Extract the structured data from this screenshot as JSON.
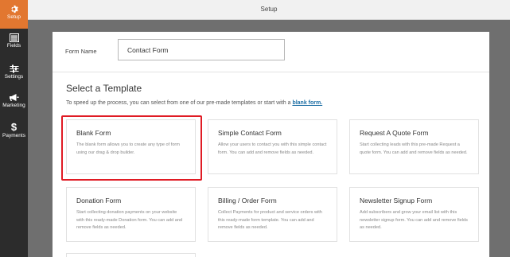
{
  "sidebar": {
    "items": [
      {
        "label": "Setup",
        "icon": "gear-icon",
        "active": true
      },
      {
        "label": "Fields",
        "icon": "fields-icon",
        "active": false
      },
      {
        "label": "Settings",
        "icon": "sliders-icon",
        "active": false
      },
      {
        "label": "Marketing",
        "icon": "megaphone-icon",
        "active": false
      },
      {
        "label": "Payments",
        "icon": "dollar-icon",
        "active": false
      }
    ]
  },
  "header": {
    "title": "Setup"
  },
  "form_name": {
    "label": "Form Name",
    "value": "Contact Form"
  },
  "templates": {
    "heading": "Select a Template",
    "subtitle_prefix": "To speed up the process, you can select from one of our pre-made templates or start with a ",
    "subtitle_link": "blank form.",
    "cards": [
      {
        "title": "Blank Form",
        "desc": "The blank form allows you to create any type of form using our drag & drop builder."
      },
      {
        "title": "Simple Contact Form",
        "desc": "Allow your users to contact you with this simple contact form. You can add and remove fields as needed."
      },
      {
        "title": "Request A Quote Form",
        "desc": "Start collecting leads with this pre-made Request a quote form. You can add and remove fields as needed."
      },
      {
        "title": "Donation Form",
        "desc": "Start collecting donation payments on your website with this ready-made Donation form. You can add and remove fields as needed."
      },
      {
        "title": "Billing / Order Form",
        "desc": "Collect Payments for product and service orders with this ready-made form template. You can add and remove fields as needed."
      },
      {
        "title": "Newsletter Signup Form",
        "desc": "Add subscribers and grow your email list with this newsletter signup form. You can add and remove fields as needed."
      }
    ]
  },
  "colors": {
    "sidebar": "#2c2c2c",
    "active": "#e27730",
    "highlight": "#e01b24",
    "link": "#1d6fa5"
  }
}
